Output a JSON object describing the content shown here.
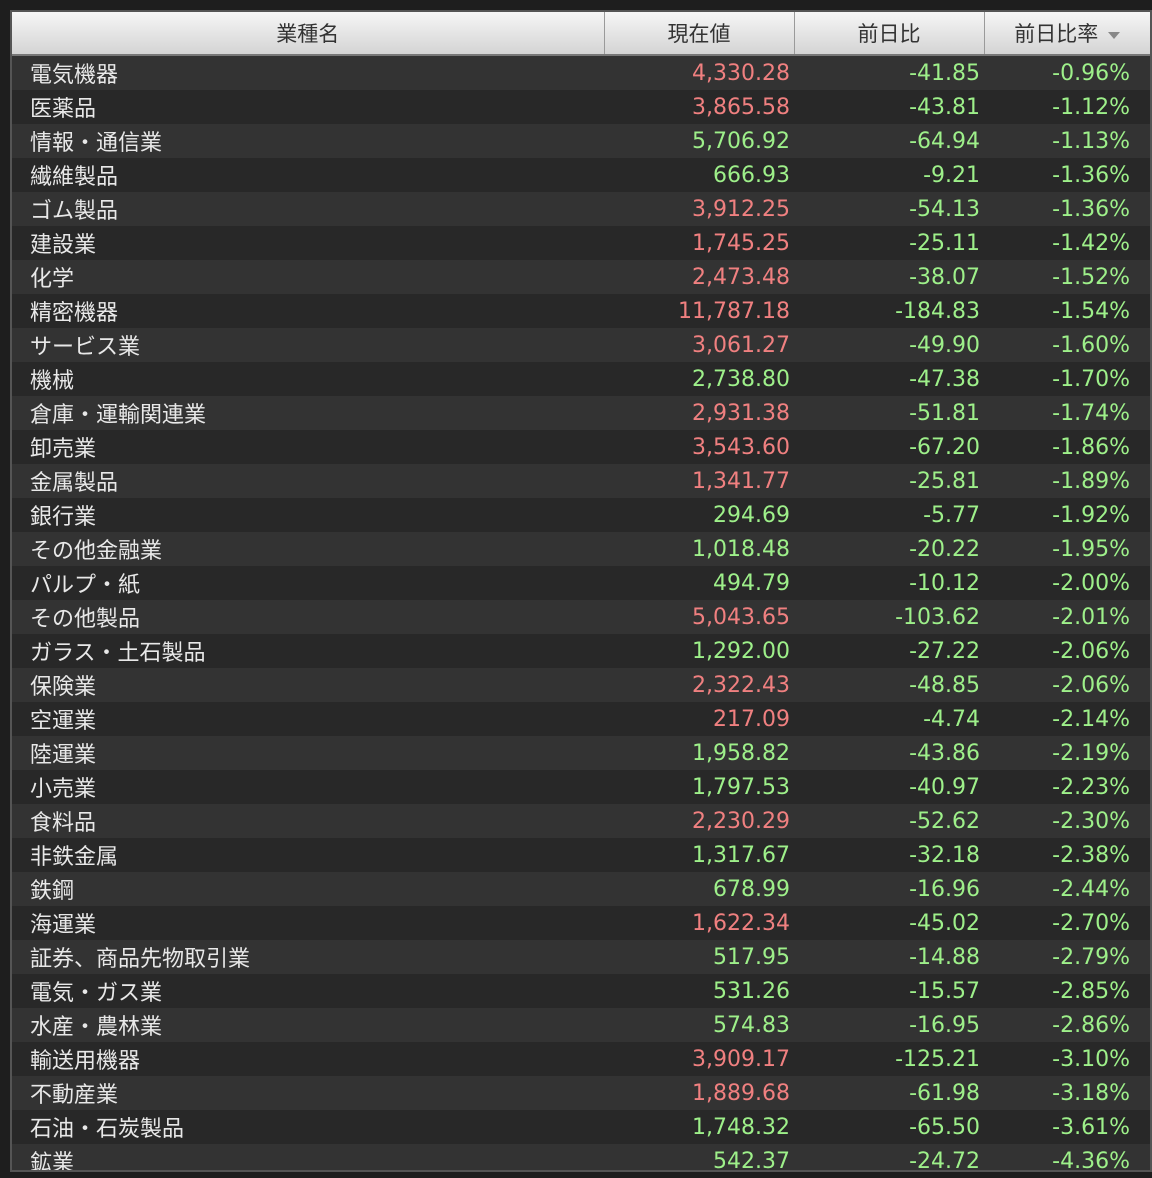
{
  "header": {
    "col_name": "業種名",
    "col_price": "現在値",
    "col_change": "前日比",
    "col_pct": "前日比率"
  },
  "colors": {
    "price_up": "#f08080",
    "price_down": "#9ef08a",
    "change": "#9ef08a"
  },
  "rows": [
    {
      "name": "電気機器",
      "price": "4,330.28",
      "change": "-41.85",
      "pct": "-0.96%",
      "price_color": "red"
    },
    {
      "name": "医薬品",
      "price": "3,865.58",
      "change": "-43.81",
      "pct": "-1.12%",
      "price_color": "red"
    },
    {
      "name": "情報・通信業",
      "price": "5,706.92",
      "change": "-64.94",
      "pct": "-1.13%",
      "price_color": "green"
    },
    {
      "name": "繊維製品",
      "price": "666.93",
      "change": "-9.21",
      "pct": "-1.36%",
      "price_color": "green"
    },
    {
      "name": "ゴム製品",
      "price": "3,912.25",
      "change": "-54.13",
      "pct": "-1.36%",
      "price_color": "red"
    },
    {
      "name": "建設業",
      "price": "1,745.25",
      "change": "-25.11",
      "pct": "-1.42%",
      "price_color": "red"
    },
    {
      "name": "化学",
      "price": "2,473.48",
      "change": "-38.07",
      "pct": "-1.52%",
      "price_color": "red"
    },
    {
      "name": "精密機器",
      "price": "11,787.18",
      "change": "-184.83",
      "pct": "-1.54%",
      "price_color": "red"
    },
    {
      "name": "サービス業",
      "price": "3,061.27",
      "change": "-49.90",
      "pct": "-1.60%",
      "price_color": "red"
    },
    {
      "name": "機械",
      "price": "2,738.80",
      "change": "-47.38",
      "pct": "-1.70%",
      "price_color": "green"
    },
    {
      "name": "倉庫・運輸関連業",
      "price": "2,931.38",
      "change": "-51.81",
      "pct": "-1.74%",
      "price_color": "red"
    },
    {
      "name": "卸売業",
      "price": "3,543.60",
      "change": "-67.20",
      "pct": "-1.86%",
      "price_color": "red"
    },
    {
      "name": "金属製品",
      "price": "1,341.77",
      "change": "-25.81",
      "pct": "-1.89%",
      "price_color": "red"
    },
    {
      "name": "銀行業",
      "price": "294.69",
      "change": "-5.77",
      "pct": "-1.92%",
      "price_color": "green"
    },
    {
      "name": "その他金融業",
      "price": "1,018.48",
      "change": "-20.22",
      "pct": "-1.95%",
      "price_color": "green"
    },
    {
      "name": "パルプ・紙",
      "price": "494.79",
      "change": "-10.12",
      "pct": "-2.00%",
      "price_color": "green"
    },
    {
      "name": "その他製品",
      "price": "5,043.65",
      "change": "-103.62",
      "pct": "-2.01%",
      "price_color": "red"
    },
    {
      "name": "ガラス・土石製品",
      "price": "1,292.00",
      "change": "-27.22",
      "pct": "-2.06%",
      "price_color": "green"
    },
    {
      "name": "保険業",
      "price": "2,322.43",
      "change": "-48.85",
      "pct": "-2.06%",
      "price_color": "red"
    },
    {
      "name": "空運業",
      "price": "217.09",
      "change": "-4.74",
      "pct": "-2.14%",
      "price_color": "red"
    },
    {
      "name": "陸運業",
      "price": "1,958.82",
      "change": "-43.86",
      "pct": "-2.19%",
      "price_color": "green"
    },
    {
      "name": "小売業",
      "price": "1,797.53",
      "change": "-40.97",
      "pct": "-2.23%",
      "price_color": "green"
    },
    {
      "name": "食料品",
      "price": "2,230.29",
      "change": "-52.62",
      "pct": "-2.30%",
      "price_color": "red"
    },
    {
      "name": "非鉄金属",
      "price": "1,317.67",
      "change": "-32.18",
      "pct": "-2.38%",
      "price_color": "green"
    },
    {
      "name": "鉄鋼",
      "price": "678.99",
      "change": "-16.96",
      "pct": "-2.44%",
      "price_color": "green"
    },
    {
      "name": "海運業",
      "price": "1,622.34",
      "change": "-45.02",
      "pct": "-2.70%",
      "price_color": "red"
    },
    {
      "name": "証券、商品先物取引業",
      "price": "517.95",
      "change": "-14.88",
      "pct": "-2.79%",
      "price_color": "green"
    },
    {
      "name": "電気・ガス業",
      "price": "531.26",
      "change": "-15.57",
      "pct": "-2.85%",
      "price_color": "green"
    },
    {
      "name": "水産・農林業",
      "price": "574.83",
      "change": "-16.95",
      "pct": "-2.86%",
      "price_color": "green"
    },
    {
      "name": "輸送用機器",
      "price": "3,909.17",
      "change": "-125.21",
      "pct": "-3.10%",
      "price_color": "red"
    },
    {
      "name": "不動産業",
      "price": "1,889.68",
      "change": "-61.98",
      "pct": "-3.18%",
      "price_color": "red"
    },
    {
      "name": "石油・石炭製品",
      "price": "1,748.32",
      "change": "-65.50",
      "pct": "-3.61%",
      "price_color": "green"
    },
    {
      "name": "鉱業",
      "price": "542.37",
      "change": "-24.72",
      "pct": "-4.36%",
      "price_color": "green"
    }
  ]
}
